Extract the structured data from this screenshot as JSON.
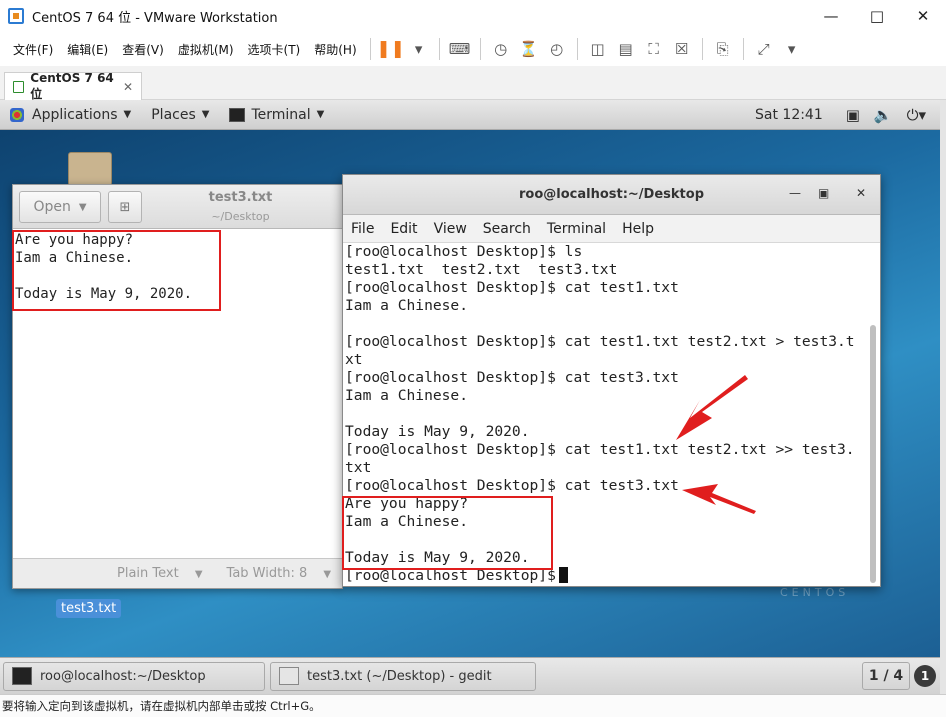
{
  "window": {
    "title": "CentOS 7 64 位 - VMware Workstation"
  },
  "vm_menu": [
    "文件(F)",
    "编辑(E)",
    "查看(V)",
    "虚拟机(M)",
    "选项卡(T)",
    "帮助(H)"
  ],
  "vm_tab": {
    "label": "CentOS 7 64 位"
  },
  "gnome": {
    "applications": "Applications",
    "places": "Places",
    "terminal": "Terminal",
    "clock": "Sat 12:41"
  },
  "desktop": {
    "file_icon_label": "test3.txt",
    "watermark": "CENTOS"
  },
  "gedit": {
    "open_label": "Open",
    "title": "test3.txt",
    "path": "~/Desktop",
    "content": "Are you happy?\nIam a Chinese.\n\nToday is May 9, 2020.",
    "status_language": "Plain Text",
    "status_tab_width": "Tab Width: 8"
  },
  "terminal": {
    "title": "roo@localhost:~/Desktop",
    "menu": [
      "File",
      "Edit",
      "View",
      "Search",
      "Terminal",
      "Help"
    ],
    "output": "[roo@localhost Desktop]$ ls\ntest1.txt  test2.txt  test3.txt\n[roo@localhost Desktop]$ cat test1.txt\nIam a Chinese.\n\n[roo@localhost Desktop]$ cat test1.txt test2.txt > test3.t\nxt\n[roo@localhost Desktop]$ cat test3.txt\nIam a Chinese.\n\nToday is May 9, 2020.\n[roo@localhost Desktop]$ cat test1.txt test2.txt >> test3.\ntxt\n[roo@localhost Desktop]$ cat test3.txt\nAre you happy?\nIam a Chinese.\n\nToday is May 9, 2020.\n[roo@localhost Desktop]$"
  },
  "taskbar": {
    "task_terminal": "roo@localhost:~/Desktop",
    "task_gedit": "test3.txt (~/Desktop) - gedit",
    "workspace": "1 / 4",
    "notifications": "1"
  },
  "vm_status": {
    "hint": "要将输入定向到该虚拟机，请在虚拟机内部单击或按 Ctrl+G。"
  },
  "colors": {
    "annotation_red": "#e01e1e",
    "pause_orange": "#f07b1f"
  }
}
